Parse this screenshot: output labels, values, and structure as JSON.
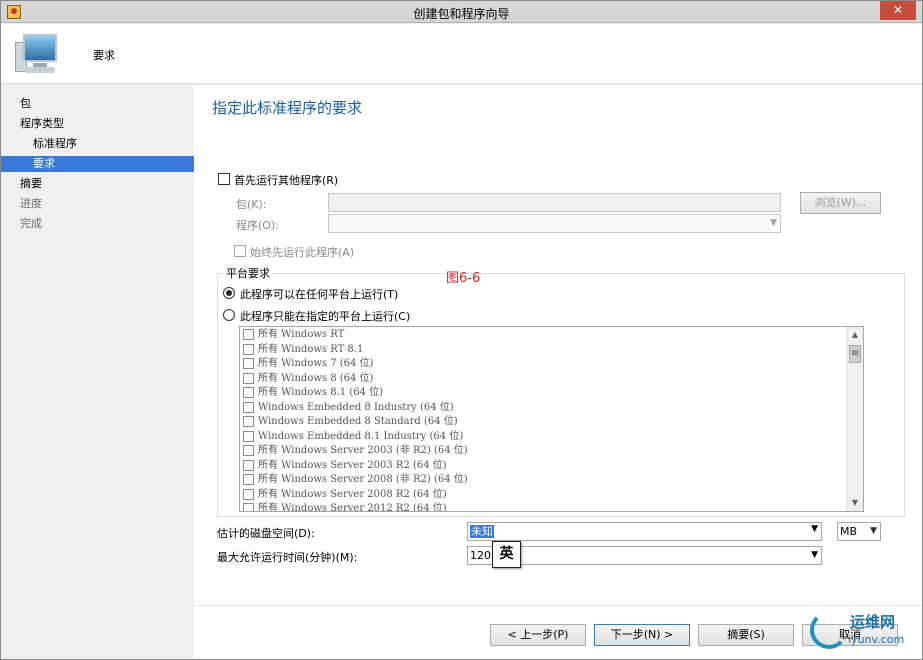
{
  "window": {
    "title": "创建包和程序向导",
    "close_glyph": "✕"
  },
  "header": {
    "title": "要求",
    "icon": "computer-icon"
  },
  "sidebar": {
    "items": [
      {
        "label": "包"
      },
      {
        "label": "程序类型"
      },
      {
        "label": "标准程序"
      },
      {
        "label": "要求"
      },
      {
        "label": "摘要"
      },
      {
        "label": "进度"
      },
      {
        "label": "完成"
      }
    ]
  },
  "main": {
    "title": "指定此标准程序的要求",
    "run_other": {
      "label": "首先运行其他程序(R)",
      "package_label": "包(K):",
      "program_label": "程序(O):",
      "browse_label": "浏览(W)...",
      "always_first_label": "始终先运行此程序(A)"
    },
    "platform": {
      "legend": "平台要求",
      "figure_label": "图6-6",
      "any_label": "此程序可以在任何平台上运行(T)",
      "specific_label": "此程序只能在指定的平台上运行(C)",
      "items": [
        "所有 Windows RT",
        "所有 Windows RT 8.1",
        "所有 Windows 7 (64 位)",
        "所有 Windows 8 (64 位)",
        "所有 Windows 8.1 (64 位)",
        "Windows Embedded 8 Industry (64 位)",
        "Windows Embedded 8 Standard (64 位)",
        "Windows Embedded 8.1 Industry (64 位)",
        "所有 Windows Server 2003 (非 R2) (64 位)",
        "所有 Windows Server 2003 R2 (64 位)",
        "所有 Windows Server 2008 (非 R2) (64 位)",
        "所有 Windows Server 2008 R2 (64 位)",
        "所有 Windows Server 2012 R2 (64 位)"
      ]
    },
    "disk": {
      "label": "估计的磁盘空间(D):",
      "value": "未知",
      "unit": "MB"
    },
    "time": {
      "label": "最大允许运行时间(分钟)(M):",
      "value": "120",
      "ime": "英"
    }
  },
  "footer": {
    "back_label": "< 上一步(P)",
    "next_label": "下一步(N) >",
    "summary_label": "摘要(S)",
    "cancel_label": "取消"
  },
  "watermark": {
    "text1": "运维网",
    "text2": "iyunv.com"
  }
}
